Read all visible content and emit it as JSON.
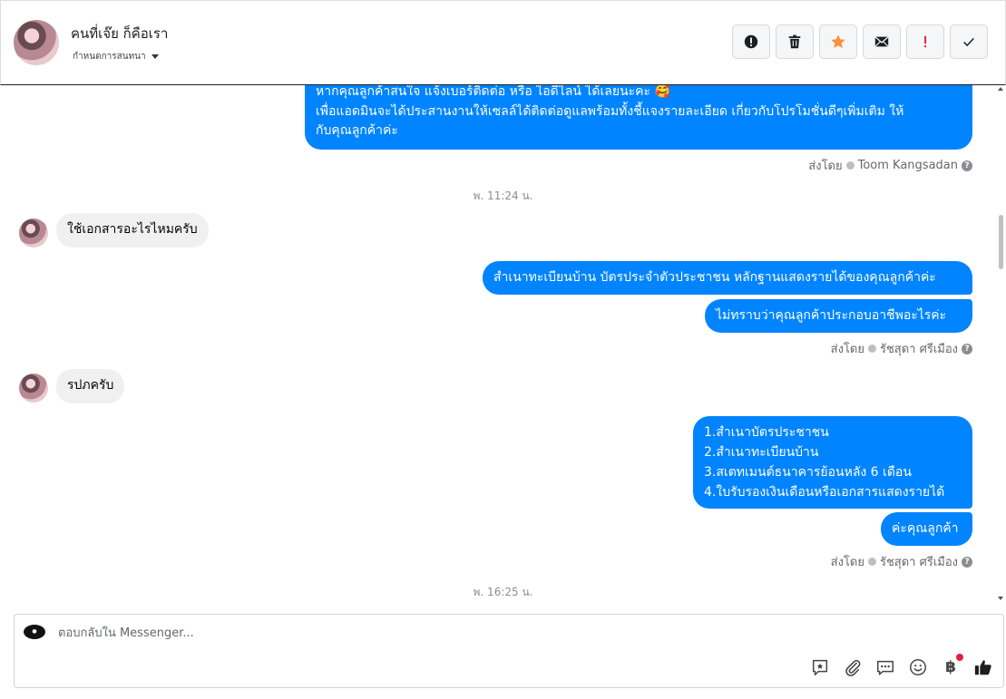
{
  "header": {
    "contact_name": "คนที่เจ๊ย ก็คือเรา",
    "assign_label": "กำหนดการสนทนา",
    "actions": [
      {
        "name": "report-spam-button",
        "icon": "alert-circle-icon"
      },
      {
        "name": "delete-button",
        "icon": "trash-icon"
      },
      {
        "name": "star-button",
        "icon": "star-icon"
      },
      {
        "name": "mark-unread-button",
        "icon": "envelope-icon"
      },
      {
        "name": "follow-up-button",
        "icon": "exclamation-icon"
      },
      {
        "name": "mark-done-button",
        "icon": "check-icon"
      }
    ],
    "colors": {
      "star": "#f7923a",
      "exclamation": "#e41e3f"
    }
  },
  "messages": {
    "m1_line1": "หากคุณลูกค้าสนใจ แจ้งเบอร์ติดต่อ หรือ ไอดีไลน์ ได้เลยนะคะ 🥰",
    "m1_line2": "เพื่อแอดมินจะได้ประสานงานให้เซลล์ได้ติดต่อดูแลพร้อมทั้งชี้แจงรายละเอียด เกี่ยวกับโปรโมชั่นดีๆเพิ่มเติม ให้",
    "m1_line3": "กับคุณลูกค้าค่ะ",
    "sent_by_1_prefix": "ส่งโดย",
    "sent_by_1_name": "Toom Kangsadan",
    "time_1": "พ. 11:24 น.",
    "in_1": "ใช้เอกสารอะไรไหมครับ",
    "out_2": "สำเนาทะเบียนบ้าน บัตรประจำตัวประชาชน หลักฐานแสดงรายได้ของคุณลูกค้าค่ะ",
    "out_3": "ไม่ทราบว่าคุณลูกค้าประกอบอาชีพอะไรค่ะ",
    "sent_by_2_prefix": "ส่งโดย",
    "sent_by_2_name": "รัชสุดา ศรีเมือง",
    "in_2": "รปภครับ",
    "out_4_line1": "1.สำเนาบัตรประชาชน",
    "out_4_line2": "2.สำเนาทะเบียนบ้าน",
    "out_4_line3": "3.สเตทเมนต์ธนาคารย้อนหลัง 6 เดือน",
    "out_4_line4": "4.ใบรับรองเงินเดือนหรือเอกสารแสดงรายได้",
    "out_5": "ค่ะคุณลูกค้า",
    "sent_by_3_prefix": "ส่งโดย",
    "sent_by_3_name": "รัชสุดา ศรีเมือง",
    "time_2": "พ. 16:25 น."
  },
  "composer": {
    "placeholder": "ตอบกลับใน Messenger...",
    "tools": [
      "saved-reply-icon",
      "attachment-icon",
      "quick-reply-icon",
      "emoji-icon",
      "payment-icon",
      "like-icon"
    ],
    "payment_symbol": "฿",
    "bubble_color": "#0084ff"
  }
}
